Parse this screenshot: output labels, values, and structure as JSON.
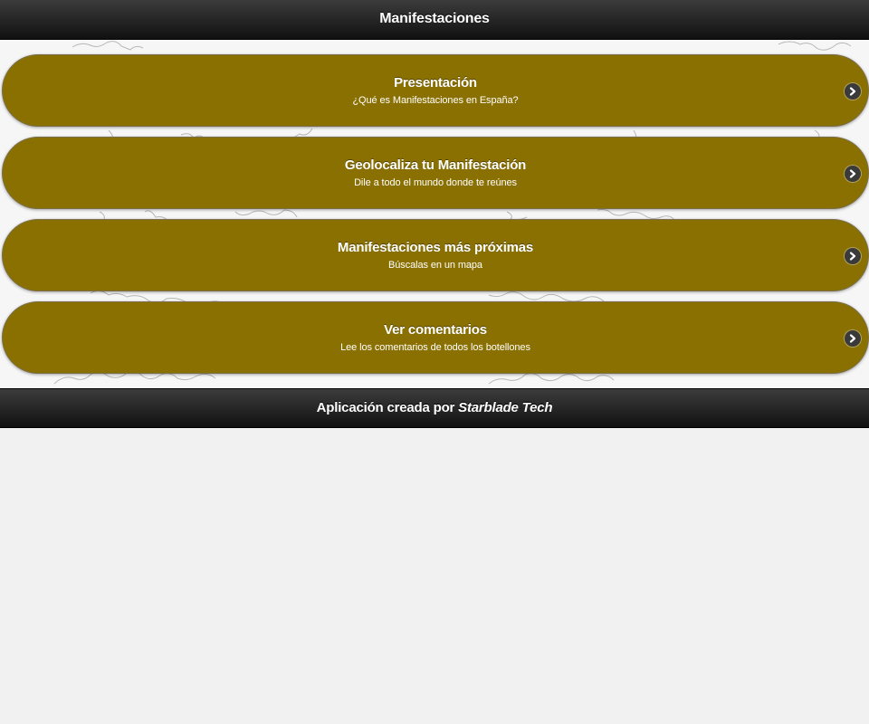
{
  "header": {
    "title": "Manifestaciones"
  },
  "menu": {
    "items": [
      {
        "title": "Presentación",
        "subtitle": "¿Qué es Manifestaciones en España?",
        "icon": "chevron-right-icon"
      },
      {
        "title": "Geolocaliza tu Manifestación",
        "subtitle": "Dile a todo el mundo donde te reúnes",
        "icon": "chevron-right-icon"
      },
      {
        "title": "Manifestaciones más próximas",
        "subtitle": "Búscalas en un mapa",
        "icon": "chevron-right-icon"
      },
      {
        "title": "Ver comentarios",
        "subtitle": "Lee los comentarios de todos los botellones",
        "icon": "chevron-right-icon"
      }
    ]
  },
  "footer": {
    "prefix": "Aplicación creada por ",
    "brand": "Starblade Tech"
  },
  "colors": {
    "accent": "#8a7000",
    "bar": "#1e1e1e",
    "page_background": "#f1f1f1"
  }
}
